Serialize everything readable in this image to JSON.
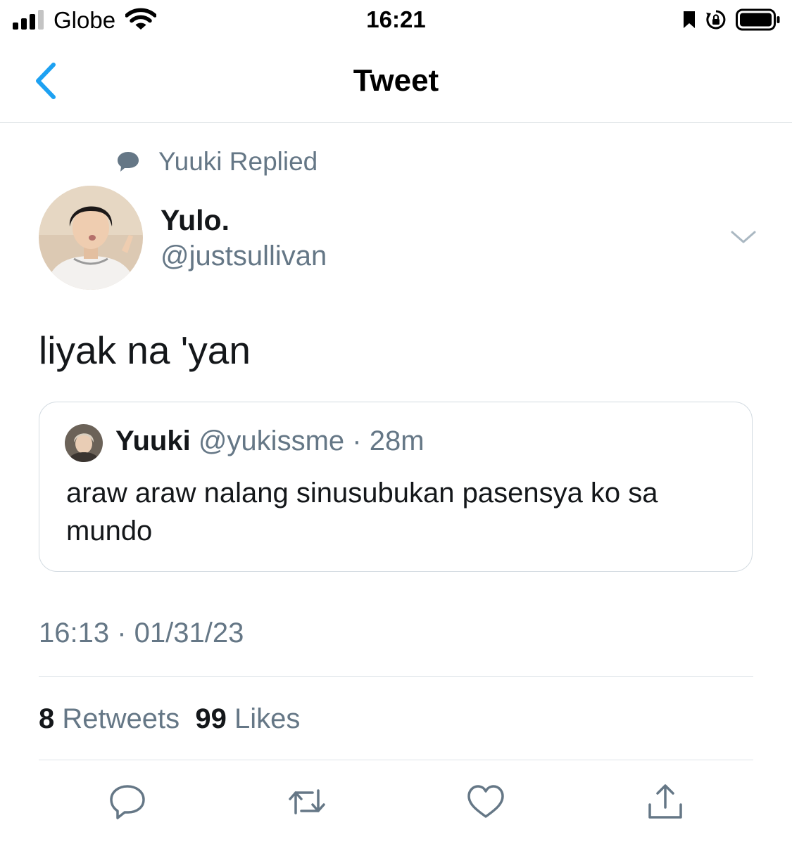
{
  "status_bar": {
    "carrier": "Globe",
    "time": "16:21",
    "icons": [
      "signal-icon",
      "wifi-icon",
      "bookmark-icon",
      "orientation-lock-icon",
      "battery-icon"
    ]
  },
  "nav": {
    "title": "Tweet",
    "back_icon": "chevron-left-icon"
  },
  "reply_context": {
    "icon": "speech-bubble-icon",
    "text": "Yuuki Replied"
  },
  "tweet": {
    "author_name": "Yulo.",
    "author_handle": "@justsullivan",
    "text": "liyak na 'yan",
    "timestamp": "16:13 · 01/31/23"
  },
  "quoted_tweet": {
    "name": "Yuuki",
    "handle": "@yukissme",
    "separator": "·",
    "age": "28m",
    "text": "araw araw nalang sinusubukan pasensya ko sa mundo"
  },
  "stats": {
    "retweets_count": "8",
    "retweets_label": "Retweets",
    "likes_count": "99",
    "likes_label": "Likes"
  },
  "actions": [
    "reply-icon",
    "retweet-icon",
    "like-icon",
    "share-icon"
  ],
  "colors": {
    "accent": "#1da1f2",
    "secondary_text": "#657786",
    "primary_text": "#14171a",
    "border": "#d3dbe1"
  }
}
